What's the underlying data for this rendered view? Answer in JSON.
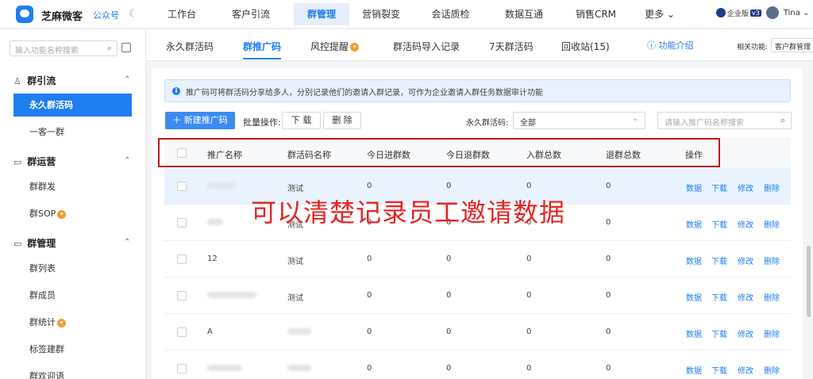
{
  "brand": {
    "name": "芝麻微客",
    "account": "公众号"
  },
  "topnav": [
    {
      "label": "工作台",
      "active": false
    },
    {
      "label": "客户引流",
      "active": false
    },
    {
      "label": "群管理",
      "active": true
    },
    {
      "label": "营销裂变",
      "active": false
    },
    {
      "label": "会话质检",
      "active": false
    },
    {
      "label": "数据互通",
      "active": false
    },
    {
      "label": "销售CRM",
      "active": false
    },
    {
      "label": "更多 ⌄",
      "active": false
    }
  ],
  "user": {
    "edition": "企业版",
    "version_badge": "v3",
    "name": "Tina ⌄"
  },
  "sidebar": {
    "search_placeholder": "输入功能名称搜索",
    "groups": [
      {
        "title": "群引流",
        "items": [
          {
            "label": "永久群活码",
            "active": true
          },
          {
            "label": "一客一群",
            "active": false
          }
        ]
      },
      {
        "title": "群运营",
        "items": [
          {
            "label": "群群发",
            "active": false
          },
          {
            "label": "群SOP",
            "active": false,
            "badge": "v2"
          }
        ]
      },
      {
        "title": "群管理",
        "items": [
          {
            "label": "群列表",
            "active": false
          },
          {
            "label": "群成员",
            "active": false
          },
          {
            "label": "群统计",
            "active": false,
            "badge": "v2"
          },
          {
            "label": "标签建群",
            "active": false
          },
          {
            "label": "群欢迎语",
            "active": false
          }
        ]
      }
    ]
  },
  "tabs": [
    {
      "label": "永久群活码",
      "active": false
    },
    {
      "label": "群推广码",
      "active": true
    },
    {
      "label": "风控提醒",
      "active": false,
      "badge": "v2"
    },
    {
      "label": "群活码导入记录",
      "active": false
    },
    {
      "label": "7天群活码",
      "active": false
    },
    {
      "label": "回收站(15)",
      "active": false
    }
  ],
  "func_intro": "功能介绍",
  "related": {
    "label": "相关功能:",
    "value": "客户群管理"
  },
  "info": "推广码可将群活码分享给多人，分别记录他们的邀请入群记录，可作为企业邀请入群任务数据审计功能",
  "toolbar": {
    "new_button": "＋ 新建推广码",
    "batch_label": "批量操作:",
    "download": "下 载",
    "delete": "删 除",
    "filter_label": "永久群活码:",
    "filter_value": "全部",
    "search_placeholder": "请输入推广码名称搜索"
  },
  "table": {
    "headers": [
      "推广名称",
      "群活码名称",
      "今日进群数",
      "今日退群数",
      "入群总数",
      "退群总数",
      "操作"
    ],
    "rows": [
      {
        "name": "",
        "code": "测试",
        "in_today": "0",
        "out_today": "0",
        "in_total": "0",
        "out_total": "0"
      },
      {
        "name": "",
        "code": "测试",
        "in_today": "0",
        "out_today": "0",
        "in_total": "0",
        "out_total": "0"
      },
      {
        "name": "12",
        "code": "测试",
        "in_today": "0",
        "out_today": "0",
        "in_total": "0",
        "out_total": "0"
      },
      {
        "name": "",
        "code": "测试",
        "in_today": "0",
        "out_today": "0",
        "in_total": "0",
        "out_total": "0"
      },
      {
        "name": "A",
        "code": "",
        "in_today": "0",
        "out_today": "0",
        "in_total": "0",
        "out_total": "0"
      },
      {
        "name": "",
        "code": "",
        "in_today": "0",
        "out_today": "0",
        "in_total": "0",
        "out_total": "0"
      }
    ],
    "actions": [
      "数据",
      "下载",
      "修改",
      "删除"
    ]
  },
  "annotation": "可以清楚记录员工邀请数据",
  "colors": {
    "accent": "#1f7ef0",
    "annotation": "#e52424",
    "highlight_box": "#b91c1c",
    "badge": "#f39c33"
  }
}
